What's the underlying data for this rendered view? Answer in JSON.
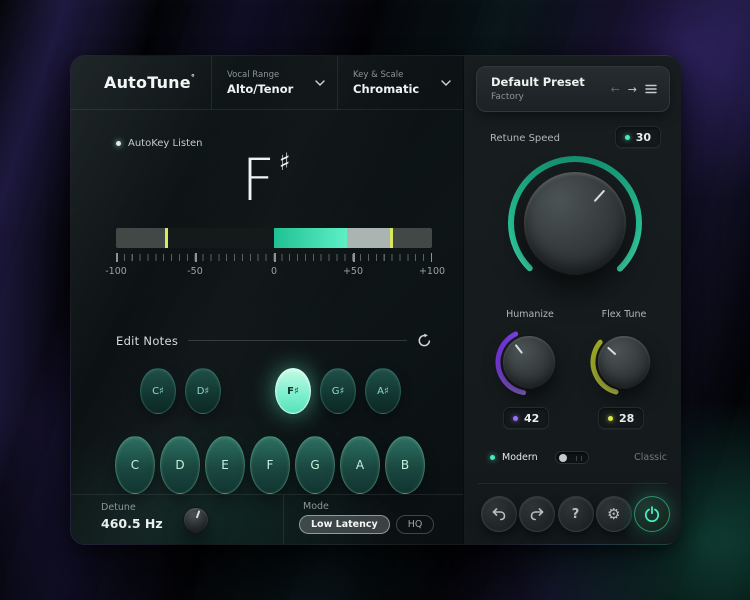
{
  "window": {
    "logo": "AutoTune",
    "logo_mark": "°"
  },
  "header": {
    "vocal_range": {
      "label": "Vocal Range",
      "value": "Alto/Tenor"
    },
    "key_scale": {
      "label": "Key & Scale",
      "value": "Chromatic"
    }
  },
  "autokey": {
    "label": "AutoKey Listen"
  },
  "note_display": {
    "note": "F",
    "accidental": "♯"
  },
  "meter": {
    "ticks": [
      "-100",
      "-50",
      "0",
      "+50",
      "+100"
    ]
  },
  "edit_notes": {
    "label": "Edit Notes"
  },
  "notes": {
    "sharps": [
      "C♯",
      "D♯",
      "F♯",
      "G♯",
      "A♯"
    ],
    "naturals": [
      "C",
      "D",
      "E",
      "F",
      "G",
      "A",
      "B"
    ],
    "active_note": "F♯"
  },
  "detune": {
    "label": "Detune",
    "value": "460.5 Hz"
  },
  "mode": {
    "label": "Mode",
    "low_latency": "Low Latency",
    "hq": "HQ",
    "selected": "Low Latency"
  },
  "preset": {
    "name": "Default Preset",
    "type": "Factory"
  },
  "retune_speed": {
    "label": "Retune Speed",
    "value": "30"
  },
  "humanize": {
    "label": "Humanize",
    "value": "42"
  },
  "flex_tune": {
    "label": "Flex Tune",
    "value": "28"
  },
  "engine_toggle": {
    "modern": "Modern",
    "classic": "Classic",
    "selected": "Modern"
  },
  "footer_buttons": {
    "help": "?",
    "gear": "⚙"
  },
  "colors": {
    "accent_teal": "#46ecc0",
    "accent_purple": "#8b5cf6",
    "accent_yellow": "#dce84e",
    "active_note_fill": "#9ef2d6",
    "meter_marker": "#d9e85c"
  }
}
